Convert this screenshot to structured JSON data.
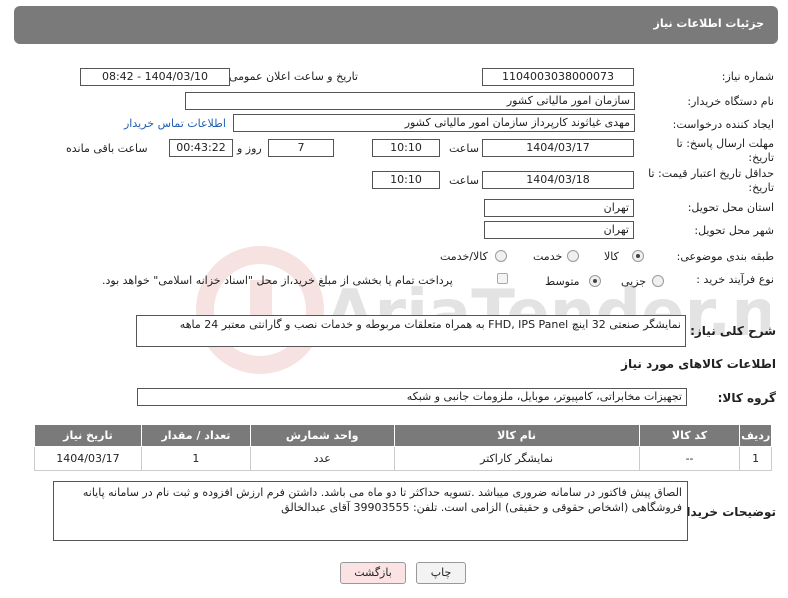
{
  "header": {
    "title": "جزئیات اطلاعات نیاز"
  },
  "fields": {
    "need_number_label": "شماره نیاز:",
    "need_number": "1104003038000073",
    "announce_label": "تاریخ و ساعت اعلان عمومی:",
    "announce_value": "1404/03/10 - 08:42",
    "buyer_org_label": "نام دستگاه خریدار:",
    "buyer_org": "سازمان امور مالیاتی کشور",
    "creator_label": "ایجاد کننده درخواست:",
    "creator": "مهدی غیاثوند کارپرداز سازمان امور مالیاتی کشور",
    "contact_link": "اطلاعات تماس خریدار",
    "deadline_label": "مهلت ارسال پاسخ: تا تاریخ:",
    "deadline_date": "1404/03/17",
    "time_label": "ساعت",
    "deadline_time": "10:10",
    "days_value": "7",
    "days_label": "روز و",
    "remaining_time": "00:43:22",
    "remaining_label": "ساعت باقی مانده",
    "price_validity_label": "حداقل تاریخ اعتبار قیمت: تا تاریخ:",
    "price_validity_date": "1404/03/18",
    "price_validity_time": "10:10",
    "province_label": "استان محل تحویل:",
    "province": "تهران",
    "city_label": "شهر محل تحویل:",
    "city": "تهران",
    "category_label": "طبقه بندی موضوعی:",
    "category_options": [
      "کالا",
      "خدمت",
      "کالا/خدمت"
    ],
    "process_label": "نوع فرآیند خرید :",
    "process_options": [
      "جزیی",
      "متوسط"
    ],
    "payment_note": "پرداخت تمام یا بخشی از مبلغ خرید،از محل \"اسناد خزانه اسلامی\" خواهد بود.",
    "description_label": "شرح کلی نیاز:",
    "description": "نمایشگر صنعتی 32 اینچ FHD, IPS Panel به همراه متعلقات مربوطه و خدمات نصب و گارانتی معتبر 24 ماهه",
    "goods_info_title": "اطلاعات کالاهای مورد نیاز",
    "goods_group_label": "گروه کالا:",
    "goods_group": "تجهیزات مخابراتی، کامپیوتر، موبایل، ملزومات جانبی و شبکه"
  },
  "table": {
    "headers": [
      "ردیف",
      "کد کالا",
      "نام کالا",
      "واحد شمارش",
      "تعداد / مقدار",
      "تاریخ نیاز"
    ],
    "rows": [
      [
        "1",
        "--",
        "نمایشگر کاراکتر",
        "عدد",
        "1",
        "1404/03/17"
      ]
    ]
  },
  "buyer_notes": {
    "label": "توضیحات خریدار:",
    "text": "الصاق پیش فاکتور در سامانه ضروری میباشد .تسویه حداکثر تا دو ماه می باشد.  داشتن فرم ارزش افزوده و ثبت نام در سامانه پایانه فروشگاهی (اشخاص حقوقی و حقیقی) الزامی است. تلفن:  39903555 آقای عبدالخالق"
  },
  "buttons": {
    "print": "چاپ",
    "back": "بازگشت"
  },
  "colors": {
    "header_bg": "#7a7a7a",
    "link": "#1f5fb0",
    "back_btn_bg": "#fbe3e3"
  }
}
